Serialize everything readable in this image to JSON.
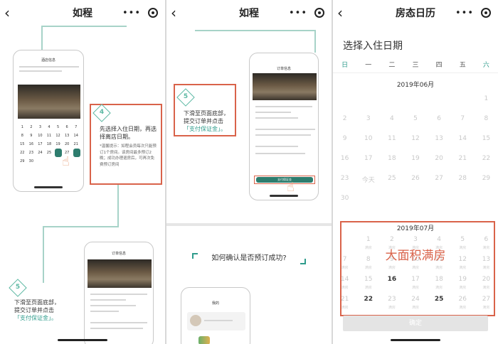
{
  "panels": [
    {
      "nav_title": "如程",
      "nav_more": "•••",
      "tip4": {
        "num": "4",
        "text": "先选择入住日期，再选择离店日期。",
        "note": "*温馨提示：如程会员每次只能预订1个房间。该房间最多预订2晚；成功办理退房后，可再次免费预订房间"
      },
      "tip5": {
        "num": "5",
        "text1": "下滑至页面底部，",
        "text2": "提交订单并点击",
        "text3": "「支付保证金」。"
      },
      "mini_phone_title": "酒店信息",
      "mini_order_title": "订单信息"
    },
    {
      "nav_title": "如程",
      "nav_more": "•••",
      "tip5": {
        "num": "5",
        "text1": "下滑至页面底部，",
        "text2": "提交订单并点击",
        "text3": "「支付保证金」。"
      },
      "question": "如何确认是否预订成功?",
      "mini_order_title": "订单信息",
      "mini_profile_title": "我的",
      "mini_pay_button": "支付保证金"
    },
    {
      "nav_title": "房态日历",
      "nav_more": "•••",
      "select_checkin": "选择入住日期",
      "weekdays": [
        "日",
        "一",
        "二",
        "三",
        "四",
        "五",
        "六"
      ],
      "month1": "2019年06月",
      "month1_rows": [
        [
          "",
          "",
          "",
          "",
          "",
          "",
          "1"
        ],
        [
          "2",
          "3",
          "4",
          "5",
          "6",
          "7",
          "8"
        ],
        [
          "9",
          "10",
          "11",
          "12",
          "13",
          "14",
          "15"
        ],
        [
          "16",
          "17",
          "18",
          "19",
          "20",
          "21",
          "22"
        ],
        [
          "23",
          "今天",
          "25",
          "26",
          "27",
          "28",
          "29"
        ],
        [
          "30",
          "",
          "",
          "",
          "",
          "",
          ""
        ]
      ],
      "month2": "2019年07月",
      "month2_rows": [
        [
          "",
          "1",
          "2",
          "3",
          "4",
          "5",
          "6"
        ],
        [
          "7",
          "8",
          "9",
          "10",
          "11",
          "12",
          "13"
        ],
        [
          "14",
          "15",
          "16",
          "17",
          "18",
          "19",
          "20"
        ],
        [
          "21",
          "22",
          "23",
          "24",
          "25",
          "26",
          "27"
        ]
      ],
      "available_dates": [
        "16",
        "22",
        "25"
      ],
      "status_full": "满房",
      "red_label": "大面积满房",
      "confirm": "确定"
    }
  ],
  "colors": {
    "accent_red": "#d9634a",
    "accent_teal": "#2f9c8c"
  }
}
